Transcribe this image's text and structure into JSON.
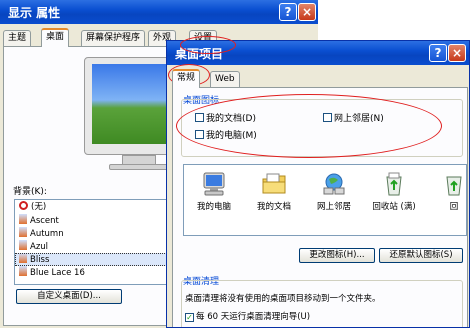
{
  "back_window": {
    "title": "显示 属性",
    "tabs": [
      "主题",
      "桌面",
      "屏幕保护程序",
      "外观",
      "设置"
    ],
    "active_tab": "桌面",
    "background_label": "背景(K):",
    "background_items": [
      {
        "label": "(无)",
        "icon": "none-icon"
      },
      {
        "label": "Ascent",
        "icon": "image-file-icon"
      },
      {
        "label": "Autumn",
        "icon": "image-file-icon"
      },
      {
        "label": "Azul",
        "icon": "image-file-icon"
      },
      {
        "label": "Bliss",
        "icon": "image-file-icon",
        "selected": true
      },
      {
        "label": "Blue Lace 16",
        "icon": "image-file-icon"
      }
    ],
    "customize_button": "自定义桌面(D)...",
    "help_button": "?",
    "close_button": "×"
  },
  "dialog": {
    "title": "桌面项目",
    "help_button": "?",
    "close_button": "×",
    "tabs": [
      "常规",
      "Web"
    ],
    "active_tab": "常规",
    "desktop_icons": {
      "title": "桌面图标",
      "checkboxes": [
        {
          "label": "我的文档(D)",
          "checked": false
        },
        {
          "label": "网上邻居(N)",
          "checked": false
        },
        {
          "label": "我的电脑(M)",
          "checked": false
        }
      ]
    },
    "icon_items": [
      {
        "label": "我的电脑",
        "icon": "my-computer-icon"
      },
      {
        "label": "我的文档",
        "icon": "my-documents-icon"
      },
      {
        "label": "网上邻居",
        "icon": "network-places-icon"
      },
      {
        "label": "回收站 (满)",
        "icon": "recycle-bin-full-icon"
      },
      {
        "label": "回",
        "icon": "recycle-bin-empty-icon"
      }
    ],
    "change_icon_button": "更改图标(H)...",
    "restore_default_button": "还原默认图标(S)",
    "cleanup": {
      "title": "桌面清理",
      "description": "桌面清理将没有使用的桌面项目移动到一个文件夹。",
      "run_wizard_label": "每 60 天运行桌面清理向导(U)",
      "run_wizard_checked": true
    }
  },
  "colors": {
    "titlebar": "#0a4fd1",
    "window_bg": "#ece9d8",
    "group_title": "#0046d5",
    "annotation": "#e02020"
  }
}
